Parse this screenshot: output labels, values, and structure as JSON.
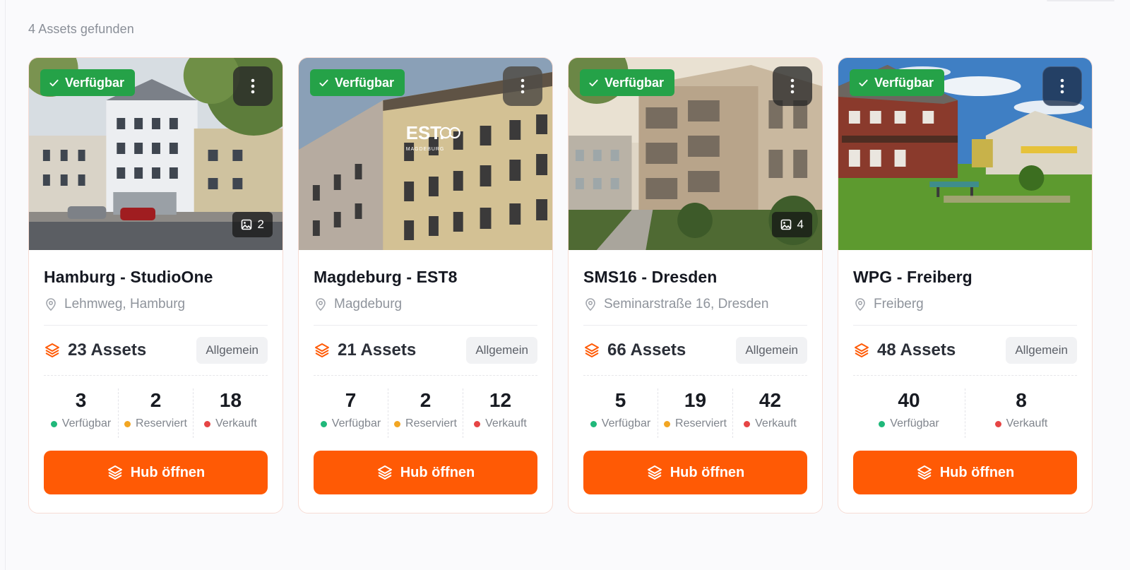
{
  "summary": "4 Assets gefunden",
  "colors": {
    "accent": "#ff5a05",
    "available": "#1fb87a",
    "reserved": "#f2a623",
    "sold": "#e64545",
    "badge": "#25a248"
  },
  "cards": [
    {
      "badge": "Verfügbar",
      "image_count": "2",
      "title": "Hamburg - StudioOne",
      "location": "Lehmweg, Hamburg",
      "assets": "23 Assets",
      "tag": "Allgemein",
      "stats": [
        {
          "value": "3",
          "label": "Verfügbar",
          "status": "available"
        },
        {
          "value": "2",
          "label": "Reserviert",
          "status": "reserved"
        },
        {
          "value": "18",
          "label": "Verkauft",
          "status": "sold"
        }
      ],
      "button": "Hub öffnen"
    },
    {
      "badge": "Verfügbar",
      "image_count": "",
      "title": "Magdeburg - EST8",
      "location": "Magdeburg",
      "logo": "EST.",
      "logo_sub": "MAGDEBURG",
      "assets": "21 Assets",
      "tag": "Allgemein",
      "stats": [
        {
          "value": "7",
          "label": "Verfügbar",
          "status": "available"
        },
        {
          "value": "2",
          "label": "Reserviert",
          "status": "reserved"
        },
        {
          "value": "12",
          "label": "Verkauft",
          "status": "sold"
        }
      ],
      "button": "Hub öffnen"
    },
    {
      "badge": "Verfügbar",
      "image_count": "4",
      "title": "SMS16 - Dresden",
      "location": "Seminarstraße 16, Dresden",
      "assets": "66 Assets",
      "tag": "Allgemein",
      "stats": [
        {
          "value": "5",
          "label": "Verfügbar",
          "status": "available"
        },
        {
          "value": "19",
          "label": "Reserviert",
          "status": "reserved"
        },
        {
          "value": "42",
          "label": "Verkauft",
          "status": "sold"
        }
      ],
      "button": "Hub öffnen"
    },
    {
      "badge": "Verfügbar",
      "image_count": "",
      "title": "WPG - Freiberg",
      "location": "Freiberg",
      "assets": "48 Assets",
      "tag": "Allgemein",
      "stats": [
        {
          "value": "40",
          "label": "Verfügbar",
          "status": "available"
        },
        {
          "value": "8",
          "label": "Verkauft",
          "status": "sold"
        }
      ],
      "button": "Hub öffnen"
    }
  ]
}
